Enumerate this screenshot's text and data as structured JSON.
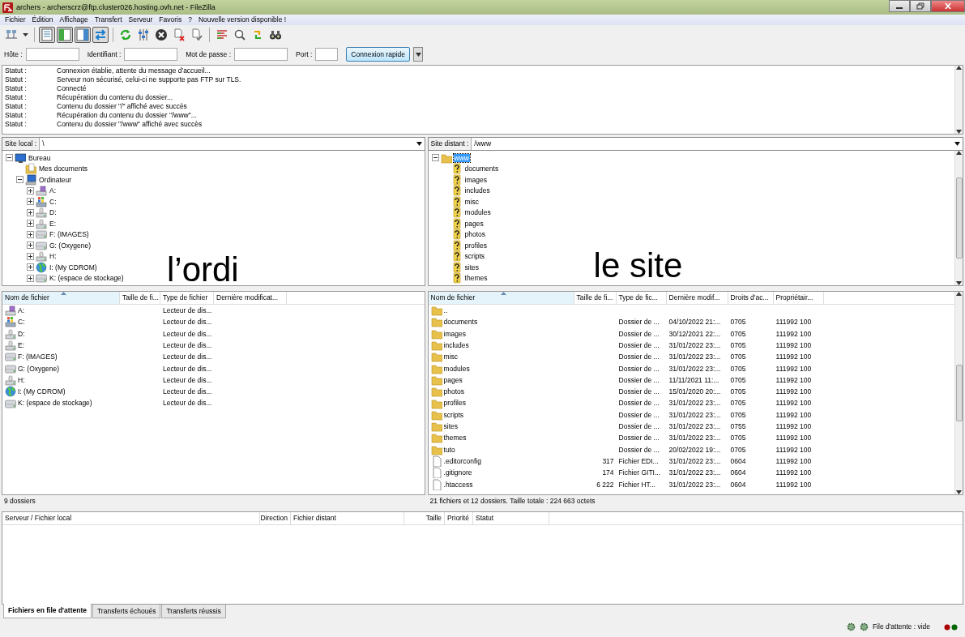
{
  "window": {
    "title": "archers - archerscrz@ftp.cluster026.hosting.ovh.net - FileZilla"
  },
  "menu": [
    "Fichier",
    "Édition",
    "Affichage",
    "Transfert",
    "Serveur",
    "Favoris",
    "?",
    "Nouvelle version disponible !"
  ],
  "toolbar": {
    "toggles": [
      {
        "on": true
      },
      {
        "on": true
      },
      {
        "on": true
      },
      {
        "on": true
      }
    ]
  },
  "quickconnect": {
    "fields": [
      {
        "label": "Hôte :"
      },
      {
        "label": "Identifiant :"
      },
      {
        "label": "Mot de passe :"
      },
      {
        "label": "Port :"
      }
    ],
    "button": "Connexion rapide"
  },
  "log": [
    {
      "label": "Statut :",
      "message": "Connexion établie, attente du message d'accueil..."
    },
    {
      "label": "Statut :",
      "message": "Serveur non sécurisé, celui-ci ne supporte pas FTP sur TLS."
    },
    {
      "label": "Statut :",
      "message": "Connecté"
    },
    {
      "label": "Statut :",
      "message": "Récupération du contenu du dossier..."
    },
    {
      "label": "Statut :",
      "message": "Contenu du dossier \"/\" affiché avec succès"
    },
    {
      "label": "Statut :",
      "message": "Récupération du contenu du dossier \"/www\"..."
    },
    {
      "label": "Statut :",
      "message": "Contenu du dossier \"/www\" affiché avec succès"
    }
  ],
  "local": {
    "site_label": "Site local :",
    "path": "\\",
    "annotation": "l’ordi",
    "tree": [
      {
        "label": "Bureau",
        "kind": "desktop",
        "expanded": true,
        "selected": false,
        "children": [
          {
            "label": "Mes documents",
            "kind": "documents",
            "selected": false
          },
          {
            "label": "Ordinateur",
            "kind": "computer",
            "expanded": true,
            "selected": false,
            "children": [
              {
                "label": "A:",
                "kind": "floppy",
                "expanded": false,
                "selected": false
              },
              {
                "label": "C:",
                "kind": "system",
                "expanded": false,
                "selected": false
              },
              {
                "label": "D:",
                "kind": "drive",
                "expanded": false,
                "selected": false
              },
              {
                "label": "E:",
                "kind": "drive",
                "expanded": false,
                "selected": false
              },
              {
                "label": "F: (IMAGES)",
                "kind": "removable",
                "expanded": false,
                "selected": false
              },
              {
                "label": "G: (Oxygene)",
                "kind": "removable",
                "expanded": false,
                "selected": false
              },
              {
                "label": "H:",
                "kind": "drive",
                "expanded": false,
                "selected": false
              },
              {
                "label": "I: (My CDROM)",
                "kind": "cdrom",
                "expanded": false,
                "selected": false
              },
              {
                "label": "K: (espace de stockage)",
                "kind": "removable",
                "expanded": false,
                "selected": false
              }
            ]
          }
        ]
      }
    ],
    "columns": [
      "Nom de fichier",
      "Taille de fi...",
      "Type de fichier",
      "Dernière modificat..."
    ],
    "files": [
      {
        "name": "A:",
        "kind": "floppy",
        "type": "Lecteur de dis..."
      },
      {
        "name": "C:",
        "kind": "system",
        "type": "Lecteur de dis..."
      },
      {
        "name": "D:",
        "kind": "drive",
        "type": "Lecteur de dis..."
      },
      {
        "name": "E:",
        "kind": "drive",
        "type": "Lecteur de dis..."
      },
      {
        "name": "F: (IMAGES)",
        "kind": "removable",
        "type": "Lecteur de dis..."
      },
      {
        "name": "G: (Oxygene)",
        "kind": "removable",
        "type": "Lecteur de dis..."
      },
      {
        "name": "H:",
        "kind": "drive",
        "type": "Lecteur de dis..."
      },
      {
        "name": "I: (My CDROM)",
        "kind": "cdrom",
        "type": "Lecteur de dis..."
      },
      {
        "name": "K: (espace de stockage)",
        "kind": "removable",
        "type": "Lecteur de dis..."
      }
    ],
    "status": "9 dossiers"
  },
  "remote": {
    "site_label": "Site distant :",
    "path": "/www",
    "annotation": "le site",
    "tree": [
      {
        "label": "www",
        "kind": "folder",
        "expanded": true,
        "selected": true,
        "children": [
          {
            "label": "documents",
            "kind": "unknown",
            "selected": false
          },
          {
            "label": "images",
            "kind": "unknown",
            "selected": false
          },
          {
            "label": "includes",
            "kind": "unknown",
            "selected": false
          },
          {
            "label": "misc",
            "kind": "unknown",
            "selected": false
          },
          {
            "label": "modules",
            "kind": "unknown",
            "selected": false
          },
          {
            "label": "pages",
            "kind": "unknown",
            "selected": false
          },
          {
            "label": "photos",
            "kind": "unknown",
            "selected": false
          },
          {
            "label": "profiles",
            "kind": "unknown",
            "selected": false
          },
          {
            "label": "scripts",
            "kind": "unknown",
            "selected": false
          },
          {
            "label": "sites",
            "kind": "unknown",
            "selected": false
          },
          {
            "label": "themes",
            "kind": "unknown",
            "selected": false
          }
        ]
      }
    ],
    "columns": [
      "Nom de fichier",
      "Taille de fi...",
      "Type de fic...",
      "Dernière modif...",
      "Droits d'ac...",
      "Propriétair..."
    ],
    "files": [
      {
        "name": "..",
        "kind": "folder"
      },
      {
        "name": "documents",
        "kind": "folder",
        "type": "Dossier de ...",
        "modified": "04/10/2022 21:...",
        "permissions": "0705",
        "owner": "111992 100"
      },
      {
        "name": "images",
        "kind": "folder",
        "type": "Dossier de ...",
        "modified": "30/12/2021 22:...",
        "permissions": "0705",
        "owner": "111992 100"
      },
      {
        "name": "includes",
        "kind": "folder",
        "type": "Dossier de ...",
        "modified": "31/01/2022 23:...",
        "permissions": "0705",
        "owner": "111992 100"
      },
      {
        "name": "misc",
        "kind": "folder",
        "type": "Dossier de ...",
        "modified": "31/01/2022 23:...",
        "permissions": "0705",
        "owner": "111992 100"
      },
      {
        "name": "modules",
        "kind": "folder",
        "type": "Dossier de ...",
        "modified": "31/01/2022 23:...",
        "permissions": "0705",
        "owner": "111992 100"
      },
      {
        "name": "pages",
        "kind": "folder",
        "type": "Dossier de ...",
        "modified": "11/11/2021 11:...",
        "permissions": "0705",
        "owner": "111992 100"
      },
      {
        "name": "photos",
        "kind": "folder",
        "type": "Dossier de ...",
        "modified": "15/01/2020 20:...",
        "permissions": "0705",
        "owner": "111992 100"
      },
      {
        "name": "profiles",
        "kind": "folder",
        "type": "Dossier de ...",
        "modified": "31/01/2022 23:...",
        "permissions": "0705",
        "owner": "111992 100"
      },
      {
        "name": "scripts",
        "kind": "folder",
        "type": "Dossier de ...",
        "modified": "31/01/2022 23:...",
        "permissions": "0705",
        "owner": "111992 100"
      },
      {
        "name": "sites",
        "kind": "folder",
        "type": "Dossier de ...",
        "modified": "31/01/2022 23:...",
        "permissions": "0755",
        "owner": "111992 100"
      },
      {
        "name": "themes",
        "kind": "folder",
        "type": "Dossier de ...",
        "modified": "31/01/2022 23:...",
        "permissions": "0705",
        "owner": "111992 100"
      },
      {
        "name": "tuto",
        "kind": "folder",
        "type": "Dossier de ...",
        "modified": "20/02/2022 19:...",
        "permissions": "0705",
        "owner": "111992 100"
      },
      {
        "name": ".editorconfig",
        "kind": "file",
        "size": "317",
        "type": "Fichier EDI...",
        "modified": "31/01/2022 23:...",
        "permissions": "0604",
        "owner": "111992 100"
      },
      {
        "name": ".gitignore",
        "kind": "file",
        "size": "174",
        "type": "Fichier GITI...",
        "modified": "31/01/2022 23:...",
        "permissions": "0604",
        "owner": "111992 100"
      },
      {
        "name": ".htaccess",
        "kind": "file",
        "size": "6 222",
        "type": "Fichier HT...",
        "modified": "31/01/2022 23:...",
        "permissions": "0604",
        "owner": "111992 100"
      }
    ],
    "status": "21 fichiers et 12 dossiers. Taille totale : 224 663 octets"
  },
  "queue": {
    "columns": [
      "Serveur / Fichier local",
      "Direction",
      "Fichier distant",
      "Taille",
      "Priorité",
      "Statut"
    ]
  },
  "tabs": [
    {
      "label": "Fichiers en file d'attente",
      "selected": true
    },
    {
      "label": "Transferts échoués",
      "selected": false
    },
    {
      "label": "Transferts réussis",
      "selected": false
    }
  ],
  "status_bar": {
    "queue": "File d'attente : vide"
  }
}
